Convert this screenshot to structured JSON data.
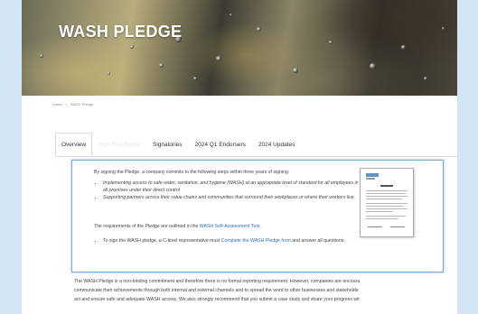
{
  "hero": {
    "title": "WASH PLEDGE"
  },
  "breadcrumb": {
    "home": "Home",
    "separator": "/",
    "current": "WASH Pledge"
  },
  "tabs": [
    {
      "label": "Overview",
      "active": true
    },
    {
      "label": "Sign the Pledge",
      "active": false,
      "faded": true
    },
    {
      "label": "Signatories",
      "active": false
    },
    {
      "label": "2024 Q1 Endorsers",
      "active": false
    },
    {
      "label": "2024 Updates",
      "active": false
    }
  ],
  "content": {
    "intro": "By signing the Pledge, a company commits to the following steps within three years of signing:",
    "bullets": [
      "Implementing access to safe water, sanitation, and hygiene (WASH) at an appropriate level of standard for all employees in all premises under their direct control",
      "Supporting partners across their value chains and communities that surround their workplaces or where their workers live."
    ],
    "requirements_prefix": "The requirements of the Pledge are outlined in the ",
    "requirements_link": "WASH Self-Assessment Tool",
    "requirements_suffix": ".",
    "sign_prefix": "To sign the WASH pledge, a C-level representative must ",
    "sign_link": "Complete the WASH Pledge form",
    "sign_suffix": " and answer all questions."
  },
  "footer": {
    "lines": [
      "The WASH Pledge is a non-binding commitment and therefore there is no formal reporting requirement. However, companies are encoura",
      "communicate their achievements through both internal and external channels and to spread the word to other businesses and stakeholde",
      "act and ensure safe and adequate WASH access. We also strongly recommend that you submit a case study and share your progress wit"
    ]
  },
  "colors": {
    "page_background": "#d3e4f5",
    "link": "#2e6fb5",
    "content_border": "#7ea9d6"
  }
}
